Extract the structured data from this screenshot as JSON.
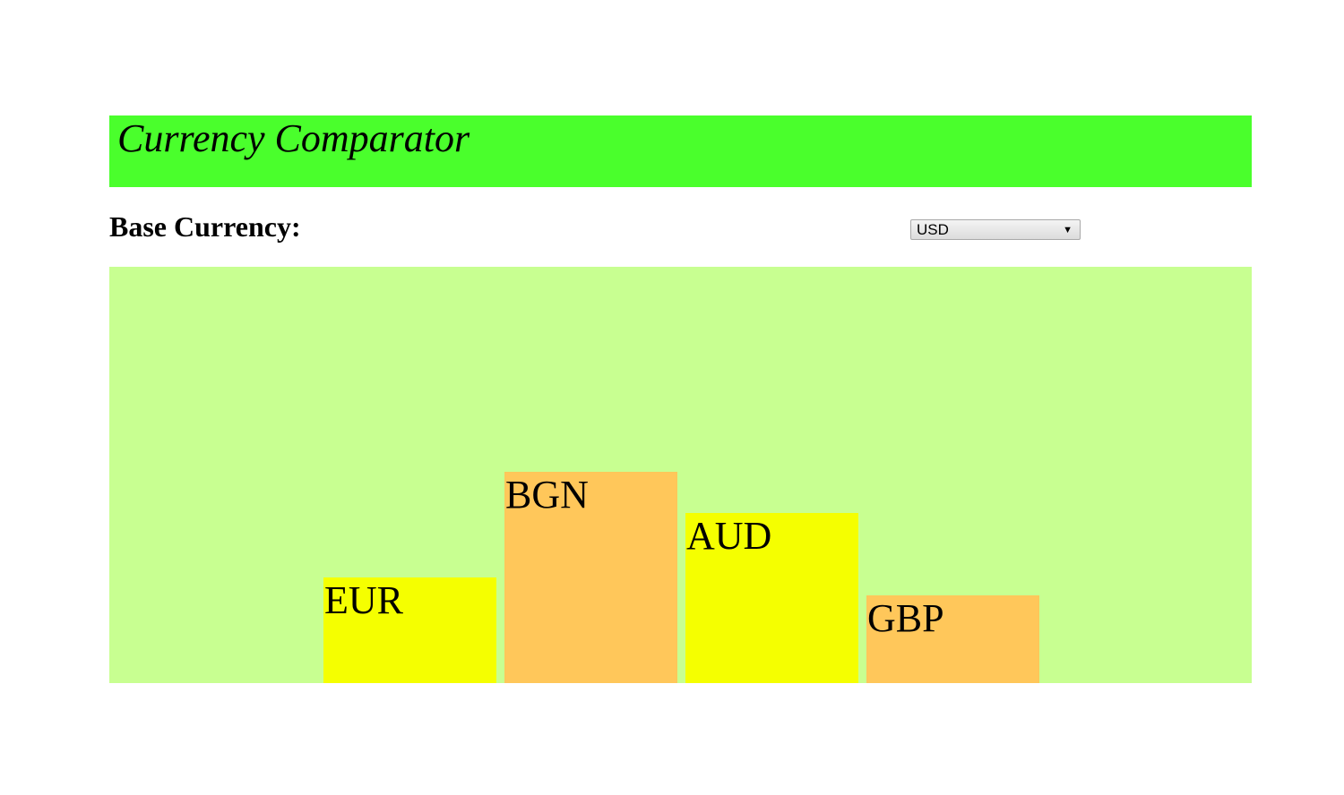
{
  "header": {
    "title": "Currency Comparator",
    "background_color": "#4aff2c"
  },
  "base_currency": {
    "label": "Base Currency:",
    "selected": "USD"
  },
  "chart_data": {
    "type": "bar",
    "categories": [
      "EUR",
      "BGN",
      "AUD",
      "GBP"
    ],
    "values": [
      0.9,
      1.8,
      1.45,
      0.75
    ],
    "colors": [
      "#f5ff00",
      "#ffc75a",
      "#f5ff00",
      "#ffc75a"
    ],
    "background_color": "#c8ff91"
  }
}
